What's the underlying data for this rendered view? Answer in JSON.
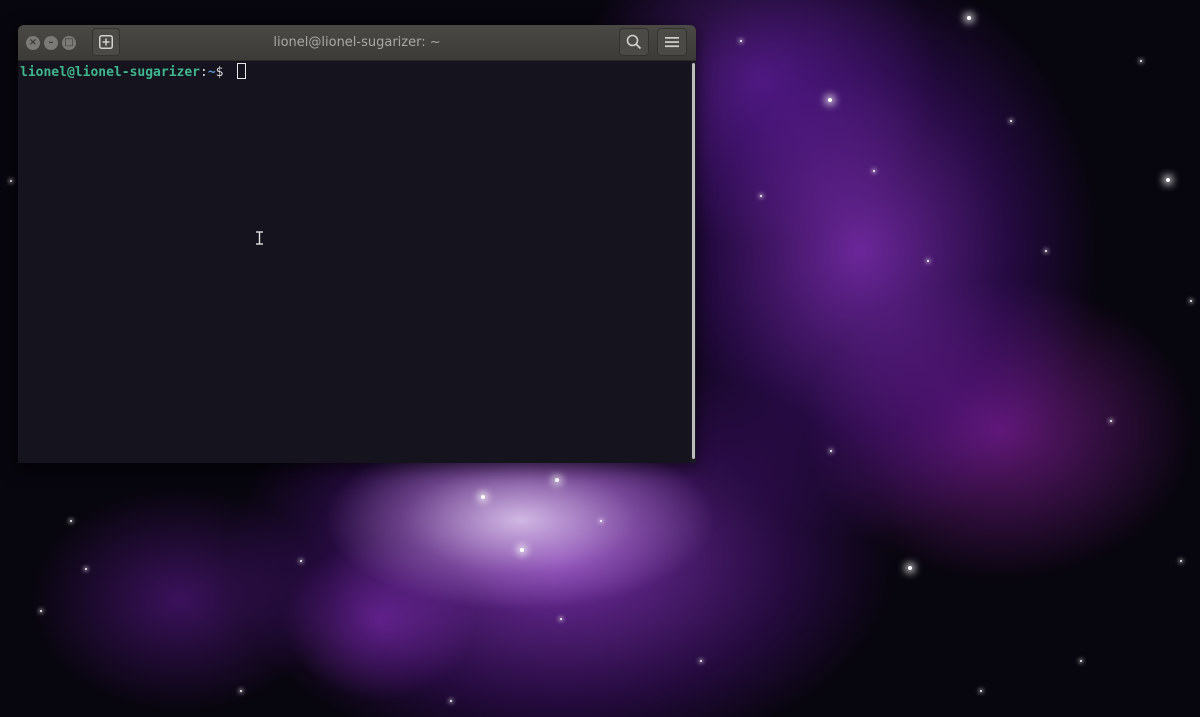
{
  "window": {
    "title": "lionel@lionel-sugarizer: ~",
    "controls": {
      "close_icon": "×",
      "minimize_icon": "–",
      "maximize_icon": "□"
    },
    "buttons": [
      "new-tab-icon",
      "search-icon",
      "hamburger-menu-icon"
    ]
  },
  "terminal": {
    "prompt": {
      "user_host": "lionel@lionel-sugarizer",
      "separator": ":",
      "directory": "~",
      "symbol": "$ "
    },
    "colors": {
      "background": "#15141e",
      "user_host": "#3fb68c",
      "directory": "#5f8fd0"
    }
  },
  "desktop": {
    "wallpaper": "purple nebula starfield"
  }
}
